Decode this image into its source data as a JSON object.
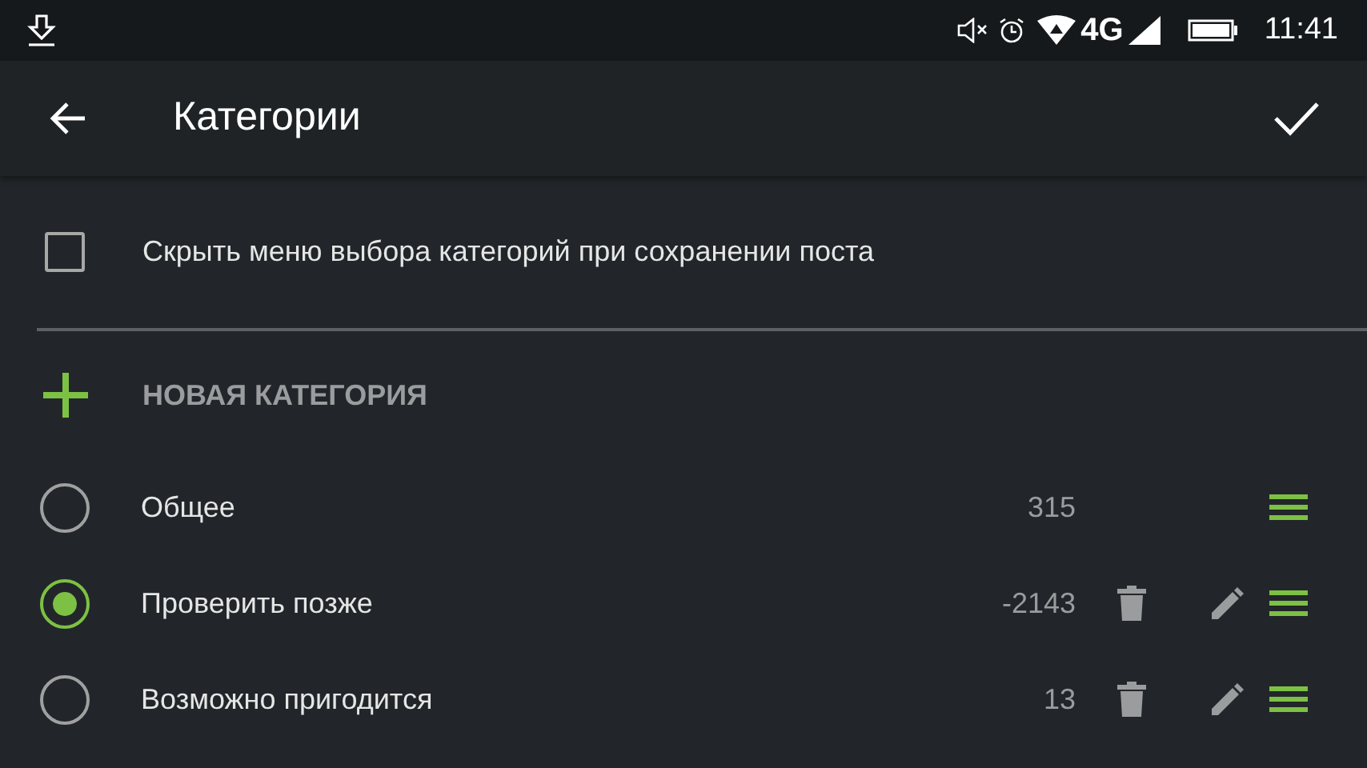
{
  "status_bar": {
    "network": "4G",
    "time": "11:41"
  },
  "toolbar": {
    "title": "Категории"
  },
  "hide_menu_option": {
    "label": "Скрыть меню выбора категорий при сохранении поста",
    "checked": false
  },
  "new_category": {
    "label": "НОВАЯ КАТЕГОРИЯ"
  },
  "categories": [
    {
      "name": "Общее",
      "count": "315",
      "selected": false,
      "editable": false
    },
    {
      "name": "Проверить позже",
      "count": "-2143",
      "selected": true,
      "editable": true
    },
    {
      "name": "Возможно пригодится",
      "count": "13",
      "selected": false,
      "editable": true
    }
  ]
}
